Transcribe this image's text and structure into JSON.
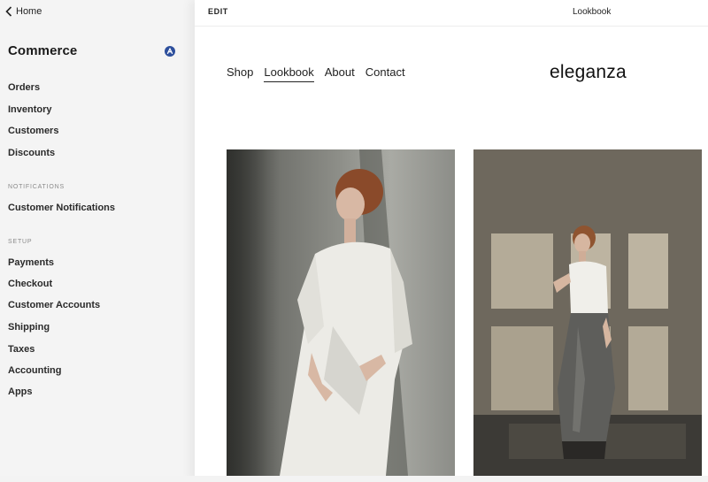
{
  "sidebar": {
    "back_label": "Home",
    "title": "Commerce",
    "items_main": [
      "Orders",
      "Inventory",
      "Customers",
      "Discounts"
    ],
    "notifications_label": "NOTIFICATIONS",
    "items_notifications": [
      "Customer Notifications"
    ],
    "setup_label": "SETUP",
    "items_setup": [
      "Payments",
      "Checkout",
      "Customer Accounts",
      "Shipping",
      "Taxes",
      "Accounting",
      "Apps"
    ]
  },
  "topbar": {
    "edit_label": "EDIT",
    "page_name": "Lookbook"
  },
  "site": {
    "nav": [
      "Shop",
      "Lookbook",
      "About",
      "Contact"
    ],
    "active_nav": "Lookbook",
    "logo": "eleganza"
  },
  "colors": {
    "sidebar_bg": "#f4f4f4",
    "badge": "#2d4f9c",
    "page_bg": "#ffffff"
  },
  "icons": {
    "back": "chevron-left-icon",
    "badge": "squarespace-badge-icon"
  },
  "images": [
    {
      "name": "lookbook-photo-1",
      "subject": "model in white dress leaning on concrete wall"
    },
    {
      "name": "lookbook-photo-2",
      "subject": "model in white top and grey skirt in sunlit room"
    }
  ]
}
